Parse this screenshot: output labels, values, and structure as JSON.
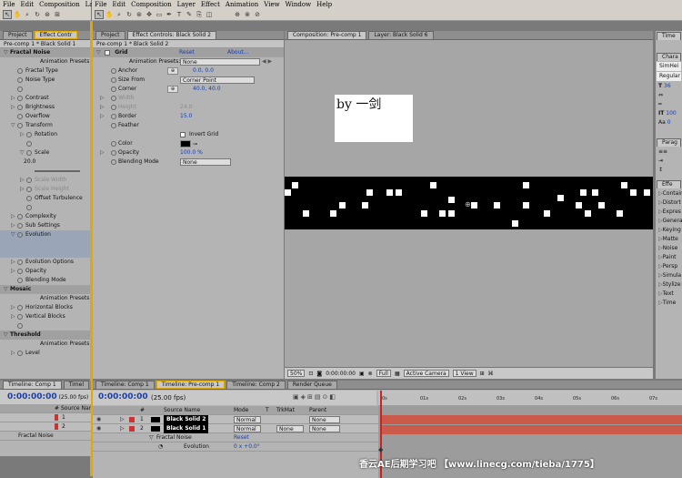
{
  "menu_left": [
    "File",
    "Edit",
    "Composition",
    "La"
  ],
  "menu_main": [
    "File",
    "Edit",
    "Composition",
    "Layer",
    "Effect",
    "Animation",
    "View",
    "Window",
    "Help"
  ],
  "left_panel": {
    "tabs": [
      "Project",
      "Effect Contr"
    ],
    "subtitle": "Pre-comp 1 * Black Solid 1",
    "rows": [
      {
        "text": "Fractal Noise",
        "type": "h",
        "tri": "▽"
      },
      {
        "text": "Animation Presets:",
        "type": "r"
      },
      {
        "text": "Fractal Type",
        "type": "p",
        "tri": ""
      },
      {
        "text": "Noise Type",
        "type": "p",
        "tri": ""
      },
      {
        "text": "",
        "type": "p",
        "tri": ""
      },
      {
        "text": "Contrast",
        "type": "p",
        "tri": "▷"
      },
      {
        "text": "Brightness",
        "type": "p",
        "tri": "▷"
      },
      {
        "text": "Overflow",
        "type": "p",
        "tri": ""
      },
      {
        "text": "Transform",
        "type": "p",
        "tri": "▽"
      },
      {
        "text": "Rotation",
        "type": "p2",
        "tri": "▷"
      },
      {
        "text": "",
        "type": "p2",
        "tri": ""
      },
      {
        "text": "Scale",
        "type": "p2",
        "tri": "▽"
      },
      {
        "text": "20.0",
        "type": "v"
      },
      {
        "text": "",
        "type": "s"
      },
      {
        "text": "Scale Width",
        "type": "dim",
        "tri": "▷"
      },
      {
        "text": "Scale Height",
        "type": "dim",
        "tri": "▷"
      },
      {
        "text": "Offset Turbulence",
        "type": "p2",
        "tri": ""
      },
      {
        "text": "",
        "type": "p2",
        "tri": ""
      },
      {
        "text": "Complexity",
        "type": "p",
        "tri": "▷"
      },
      {
        "text": "Sub Settings",
        "type": "p",
        "tri": "▷"
      },
      {
        "text": "Evolution",
        "type": "sel",
        "tri": "▽"
      },
      {
        "text": "",
        "type": "blank"
      },
      {
        "text": "",
        "type": "blank"
      },
      {
        "text": "Evolution Options",
        "type": "p",
        "tri": "▷"
      },
      {
        "text": "Opacity",
        "type": "p",
        "tri": "▷"
      },
      {
        "text": "Blending Mode",
        "type": "p",
        "tri": ""
      },
      {
        "text": "Mosaic",
        "type": "h",
        "tri": "▽"
      },
      {
        "text": "Animation Presets:",
        "type": "r"
      },
      {
        "text": "Horizontal Blocks",
        "type": "p",
        "tri": "▷"
      },
      {
        "text": "Vertical Blocks",
        "type": "p",
        "tri": "▷"
      },
      {
        "text": "",
        "type": "p",
        "tri": ""
      },
      {
        "text": "Threshold",
        "type": "h",
        "tri": "▽"
      },
      {
        "text": "Animation Presets:",
        "type": "r"
      },
      {
        "text": "Level",
        "type": "p",
        "tri": "▷"
      }
    ]
  },
  "effect_panel": {
    "tabs": [
      "Project",
      "Effect Controls: Black Solid 2"
    ],
    "subtitle": "Pre-comp 1 * Black Solid 2",
    "effect_name": "Grid",
    "reset": "Reset",
    "about": "About...",
    "presets_label": "Animation Presets:",
    "presets_value": "None",
    "rows": [
      {
        "label": "Anchor",
        "value": "0.0, 0.0",
        "kind": "point"
      },
      {
        "label": "Size From",
        "value": "Corner Point",
        "kind": "dd"
      },
      {
        "label": "Corner",
        "value": "40.0, 40.0",
        "kind": "point"
      },
      {
        "label": "Width",
        "value": "",
        "kind": "dim"
      },
      {
        "label": "Height",
        "value": "24.0",
        "kind": "dim"
      },
      {
        "label": "Border",
        "value": "15.0",
        "kind": "num"
      },
      {
        "label": "Feather",
        "value": "",
        "kind": "none"
      },
      {
        "label": "",
        "value": "Invert Grid",
        "kind": "check"
      },
      {
        "label": "Color",
        "value": "",
        "kind": "color"
      },
      {
        "label": "Opacity",
        "value": "100.0 %",
        "kind": "num"
      },
      {
        "label": "Blending Mode",
        "value": "None",
        "kind": "dd"
      }
    ]
  },
  "comp_panel": {
    "tabs": [
      "Composition: Pre-comp 1",
      "Layer: Black Solid 6"
    ],
    "text_overlay": "by 一剑",
    "footer": {
      "zoom": "50%",
      "time": "0:00:00:00",
      "quality": "Full",
      "camera": "Active Camera",
      "view": "1 View"
    }
  },
  "right_panel": {
    "tabs": [
      "Time",
      "Workspa",
      "Chara",
      "Parag",
      "Effe"
    ],
    "font1": "SimHei",
    "font2": "Regular",
    "nums": [
      "36",
      "100",
      "0"
    ],
    "effects": [
      "Contains",
      "Distort",
      "Expres",
      "Genera",
      "Keying",
      "Matte",
      "Noise",
      "Paint",
      "Persp",
      "Simula",
      "Stylize",
      "Text",
      "Time"
    ]
  },
  "timeline": {
    "left_tabs": [
      "Timeline: Comp 1",
      "Timel"
    ],
    "tabs": [
      "Timeline: Comp 1",
      "Timeline: Pre-comp 1",
      "Timeline: Comp 2",
      "Render Queue"
    ],
    "time": "0:00:00:00",
    "fps": "(25.00 fps)",
    "cols": [
      "#",
      "Source Name",
      "Mode",
      "T",
      "TrkMat",
      "Parent"
    ],
    "layers": [
      {
        "num": "1",
        "name": "Black Solid 2",
        "mode": "Normal",
        "trk": "",
        "parent": "None"
      },
      {
        "num": "2",
        "name": "Black Solid 1",
        "mode": "Normal",
        "trk": "None",
        "parent": "None"
      }
    ],
    "sub_effect": "Fractal Noise",
    "sub_reset": "Reset",
    "sub_prop": "Evolution",
    "sub_value": "0 x +0.0°",
    "ruler": [
      "0s",
      "01s",
      "02s",
      "03s",
      "04s",
      "05s",
      "06s",
      "07s"
    ]
  },
  "watermark": "香云AE后期学习吧 【www.linecg.com/tieba/1775】",
  "colors": {
    "panel": "#b4b4b4",
    "layer_bar": "#cc5a4a",
    "time_blue": "#1a3fa8",
    "accent": "#e0a800"
  }
}
